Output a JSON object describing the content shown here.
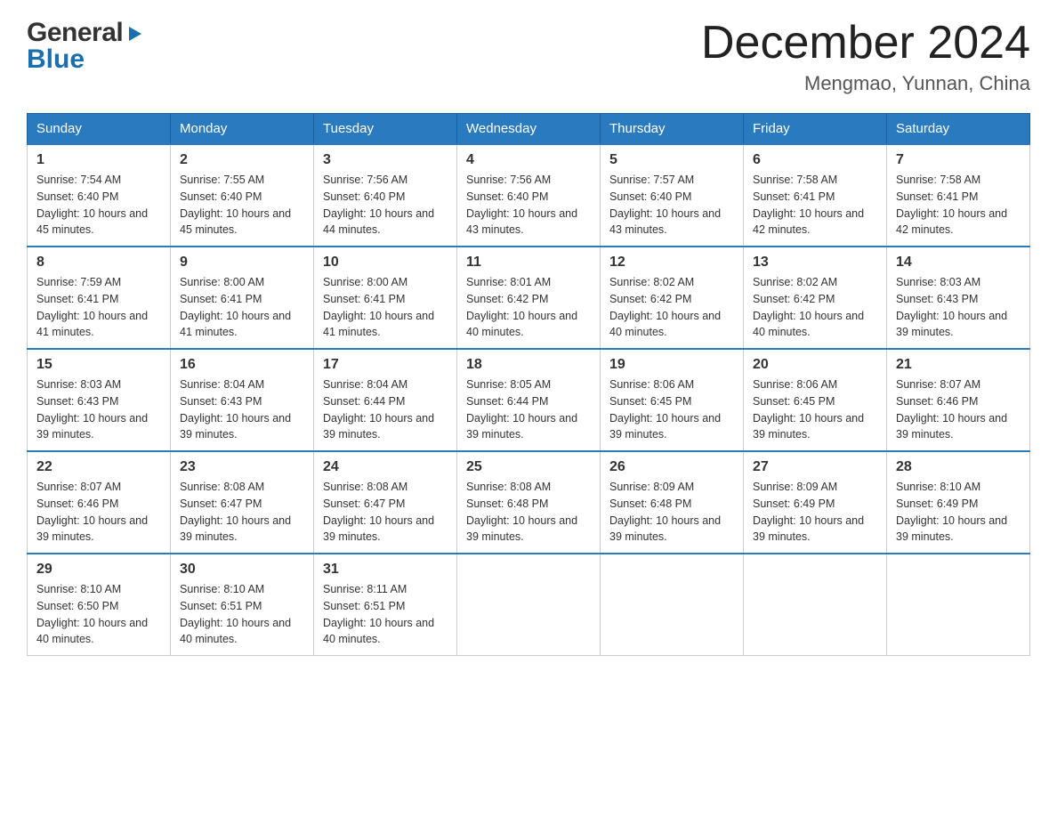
{
  "header": {
    "logo": {
      "general": "General",
      "blue": "Blue",
      "arrow_color": "#1a6faf"
    },
    "title": "December 2024",
    "location": "Mengmao, Yunnan, China"
  },
  "calendar": {
    "days_of_week": [
      "Sunday",
      "Monday",
      "Tuesday",
      "Wednesday",
      "Thursday",
      "Friday",
      "Saturday"
    ],
    "weeks": [
      [
        {
          "day": "1",
          "sunrise": "7:54 AM",
          "sunset": "6:40 PM",
          "daylight": "10 hours and 45 minutes."
        },
        {
          "day": "2",
          "sunrise": "7:55 AM",
          "sunset": "6:40 PM",
          "daylight": "10 hours and 45 minutes."
        },
        {
          "day": "3",
          "sunrise": "7:56 AM",
          "sunset": "6:40 PM",
          "daylight": "10 hours and 44 minutes."
        },
        {
          "day": "4",
          "sunrise": "7:56 AM",
          "sunset": "6:40 PM",
          "daylight": "10 hours and 43 minutes."
        },
        {
          "day": "5",
          "sunrise": "7:57 AM",
          "sunset": "6:40 PM",
          "daylight": "10 hours and 43 minutes."
        },
        {
          "day": "6",
          "sunrise": "7:58 AM",
          "sunset": "6:41 PM",
          "daylight": "10 hours and 42 minutes."
        },
        {
          "day": "7",
          "sunrise": "7:58 AM",
          "sunset": "6:41 PM",
          "daylight": "10 hours and 42 minutes."
        }
      ],
      [
        {
          "day": "8",
          "sunrise": "7:59 AM",
          "sunset": "6:41 PM",
          "daylight": "10 hours and 41 minutes."
        },
        {
          "day": "9",
          "sunrise": "8:00 AM",
          "sunset": "6:41 PM",
          "daylight": "10 hours and 41 minutes."
        },
        {
          "day": "10",
          "sunrise": "8:00 AM",
          "sunset": "6:41 PM",
          "daylight": "10 hours and 41 minutes."
        },
        {
          "day": "11",
          "sunrise": "8:01 AM",
          "sunset": "6:42 PM",
          "daylight": "10 hours and 40 minutes."
        },
        {
          "day": "12",
          "sunrise": "8:02 AM",
          "sunset": "6:42 PM",
          "daylight": "10 hours and 40 minutes."
        },
        {
          "day": "13",
          "sunrise": "8:02 AM",
          "sunset": "6:42 PM",
          "daylight": "10 hours and 40 minutes."
        },
        {
          "day": "14",
          "sunrise": "8:03 AM",
          "sunset": "6:43 PM",
          "daylight": "10 hours and 39 minutes."
        }
      ],
      [
        {
          "day": "15",
          "sunrise": "8:03 AM",
          "sunset": "6:43 PM",
          "daylight": "10 hours and 39 minutes."
        },
        {
          "day": "16",
          "sunrise": "8:04 AM",
          "sunset": "6:43 PM",
          "daylight": "10 hours and 39 minutes."
        },
        {
          "day": "17",
          "sunrise": "8:04 AM",
          "sunset": "6:44 PM",
          "daylight": "10 hours and 39 minutes."
        },
        {
          "day": "18",
          "sunrise": "8:05 AM",
          "sunset": "6:44 PM",
          "daylight": "10 hours and 39 minutes."
        },
        {
          "day": "19",
          "sunrise": "8:06 AM",
          "sunset": "6:45 PM",
          "daylight": "10 hours and 39 minutes."
        },
        {
          "day": "20",
          "sunrise": "8:06 AM",
          "sunset": "6:45 PM",
          "daylight": "10 hours and 39 minutes."
        },
        {
          "day": "21",
          "sunrise": "8:07 AM",
          "sunset": "6:46 PM",
          "daylight": "10 hours and 39 minutes."
        }
      ],
      [
        {
          "day": "22",
          "sunrise": "8:07 AM",
          "sunset": "6:46 PM",
          "daylight": "10 hours and 39 minutes."
        },
        {
          "day": "23",
          "sunrise": "8:08 AM",
          "sunset": "6:47 PM",
          "daylight": "10 hours and 39 minutes."
        },
        {
          "day": "24",
          "sunrise": "8:08 AM",
          "sunset": "6:47 PM",
          "daylight": "10 hours and 39 minutes."
        },
        {
          "day": "25",
          "sunrise": "8:08 AM",
          "sunset": "6:48 PM",
          "daylight": "10 hours and 39 minutes."
        },
        {
          "day": "26",
          "sunrise": "8:09 AM",
          "sunset": "6:48 PM",
          "daylight": "10 hours and 39 minutes."
        },
        {
          "day": "27",
          "sunrise": "8:09 AM",
          "sunset": "6:49 PM",
          "daylight": "10 hours and 39 minutes."
        },
        {
          "day": "28",
          "sunrise": "8:10 AM",
          "sunset": "6:49 PM",
          "daylight": "10 hours and 39 minutes."
        }
      ],
      [
        {
          "day": "29",
          "sunrise": "8:10 AM",
          "sunset": "6:50 PM",
          "daylight": "10 hours and 40 minutes."
        },
        {
          "day": "30",
          "sunrise": "8:10 AM",
          "sunset": "6:51 PM",
          "daylight": "10 hours and 40 minutes."
        },
        {
          "day": "31",
          "sunrise": "8:11 AM",
          "sunset": "6:51 PM",
          "daylight": "10 hours and 40 minutes."
        },
        null,
        null,
        null,
        null
      ]
    ]
  }
}
